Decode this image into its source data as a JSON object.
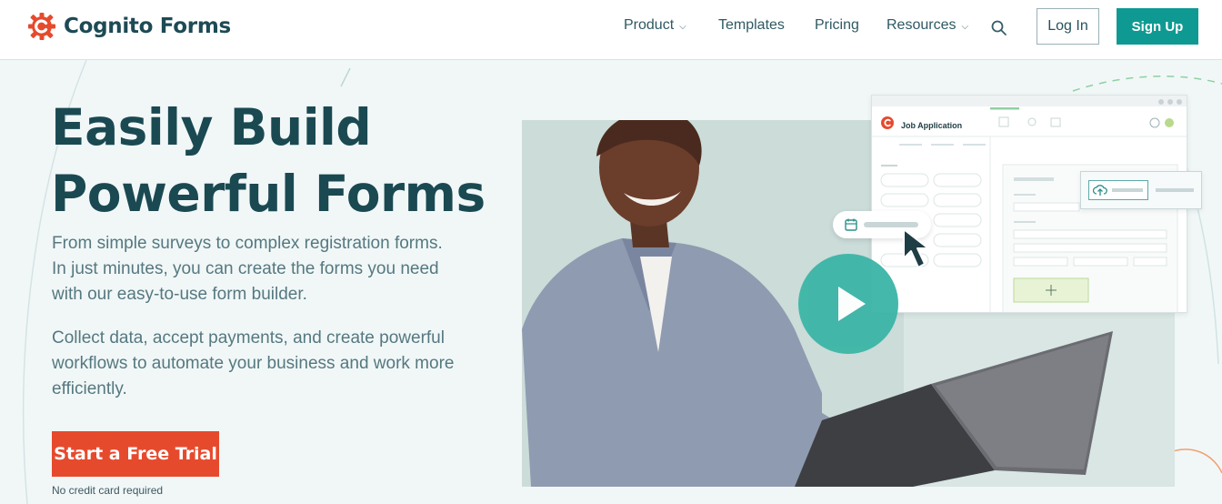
{
  "header": {
    "brand": "Cognito Forms",
    "nav": [
      {
        "label": "Product",
        "has_menu": true
      },
      {
        "label": "Templates",
        "has_menu": false
      },
      {
        "label": "Pricing",
        "has_menu": false
      },
      {
        "label": "Resources",
        "has_menu": true
      }
    ],
    "search_icon": "search-icon",
    "login_label": "Log In",
    "signup_label": "Sign Up"
  },
  "hero": {
    "headline_line1": "Easily Build",
    "headline_line2": "Powerful Forms",
    "paragraph1": "From simple surveys to complex registration forms. In just minutes, you can create the forms you need with our easy-to-use form builder.",
    "paragraph2": "Collect data, accept payments, and create powerful workflows to automate your business and work more efficiently.",
    "cta_label": "Start a Free Trial",
    "cta_note": "No credit card required"
  },
  "video": {
    "app_window_title": "Job Application",
    "play_icon": "play-icon",
    "add_icon": "plus-icon"
  },
  "colors": {
    "brand_teal": "#0e9a92",
    "cta_orange": "#e64a2d",
    "headline": "#1a4952",
    "background": "#f1f7f7",
    "play_button": "#3bb5a7"
  }
}
